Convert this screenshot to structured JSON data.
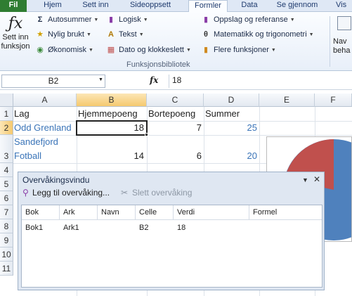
{
  "ribbon": {
    "tabs": [
      "Fil",
      "Hjem",
      "Sett inn",
      "Sideoppsett",
      "Formler",
      "Data",
      "Se gjennom",
      "Vis"
    ],
    "active_tab": "Formler",
    "insert_function": {
      "line1": "Sett inn",
      "line2": "funksjon"
    },
    "library": {
      "col1": [
        "Autosummer",
        "Nylig brukt",
        "Økonomisk"
      ],
      "col2": [
        "Logisk",
        "Tekst",
        "Dato og klokkeslett"
      ],
      "col3": [
        "Oppslag og referanse",
        "Matematikk og trigonometri",
        "Flere funksjoner"
      ]
    },
    "group_label": "Funksjonsbibliotek",
    "right_partial": {
      "line1": "Nav",
      "line2": "beha"
    }
  },
  "formula_bar": {
    "name_box": "B2",
    "fx_label": "fx",
    "value": "18"
  },
  "grid": {
    "columns": [
      "A",
      "B",
      "C",
      "D",
      "E",
      "F"
    ],
    "rows": [
      "1",
      "2",
      "3",
      "4",
      "5",
      "6",
      "7",
      "8",
      "9",
      "10",
      "11"
    ],
    "headers": {
      "A1": "Lag",
      "B1": "Hjemmepoeng",
      "C1": "Bortepoeng",
      "D1": "Summer"
    },
    "row2": {
      "A": "Odd Grenland",
      "B": "18",
      "C": "7",
      "D": "25"
    },
    "row3": {
      "A1": "Sandefjord",
      "A2": "Fotball",
      "B": "14",
      "C": "6",
      "D": "20"
    }
  },
  "watch_window": {
    "title": "Overvåkingsvindu",
    "add_label": "Legg til overvåking...",
    "delete_label": "Slett overvåking",
    "columns": [
      "Bok",
      "Ark",
      "Navn",
      "Celle",
      "Verdi",
      "Formel"
    ],
    "rows": [
      {
        "book": "Bok1",
        "sheet": "Ark1",
        "name": "",
        "cell": "B2",
        "value": "18",
        "formula": ""
      }
    ]
  },
  "colors": {
    "accent_blue": "#3a74b8",
    "file_tab": "#2f7d32",
    "pie_blue": "#4f81bd",
    "pie_red": "#c0504d"
  }
}
